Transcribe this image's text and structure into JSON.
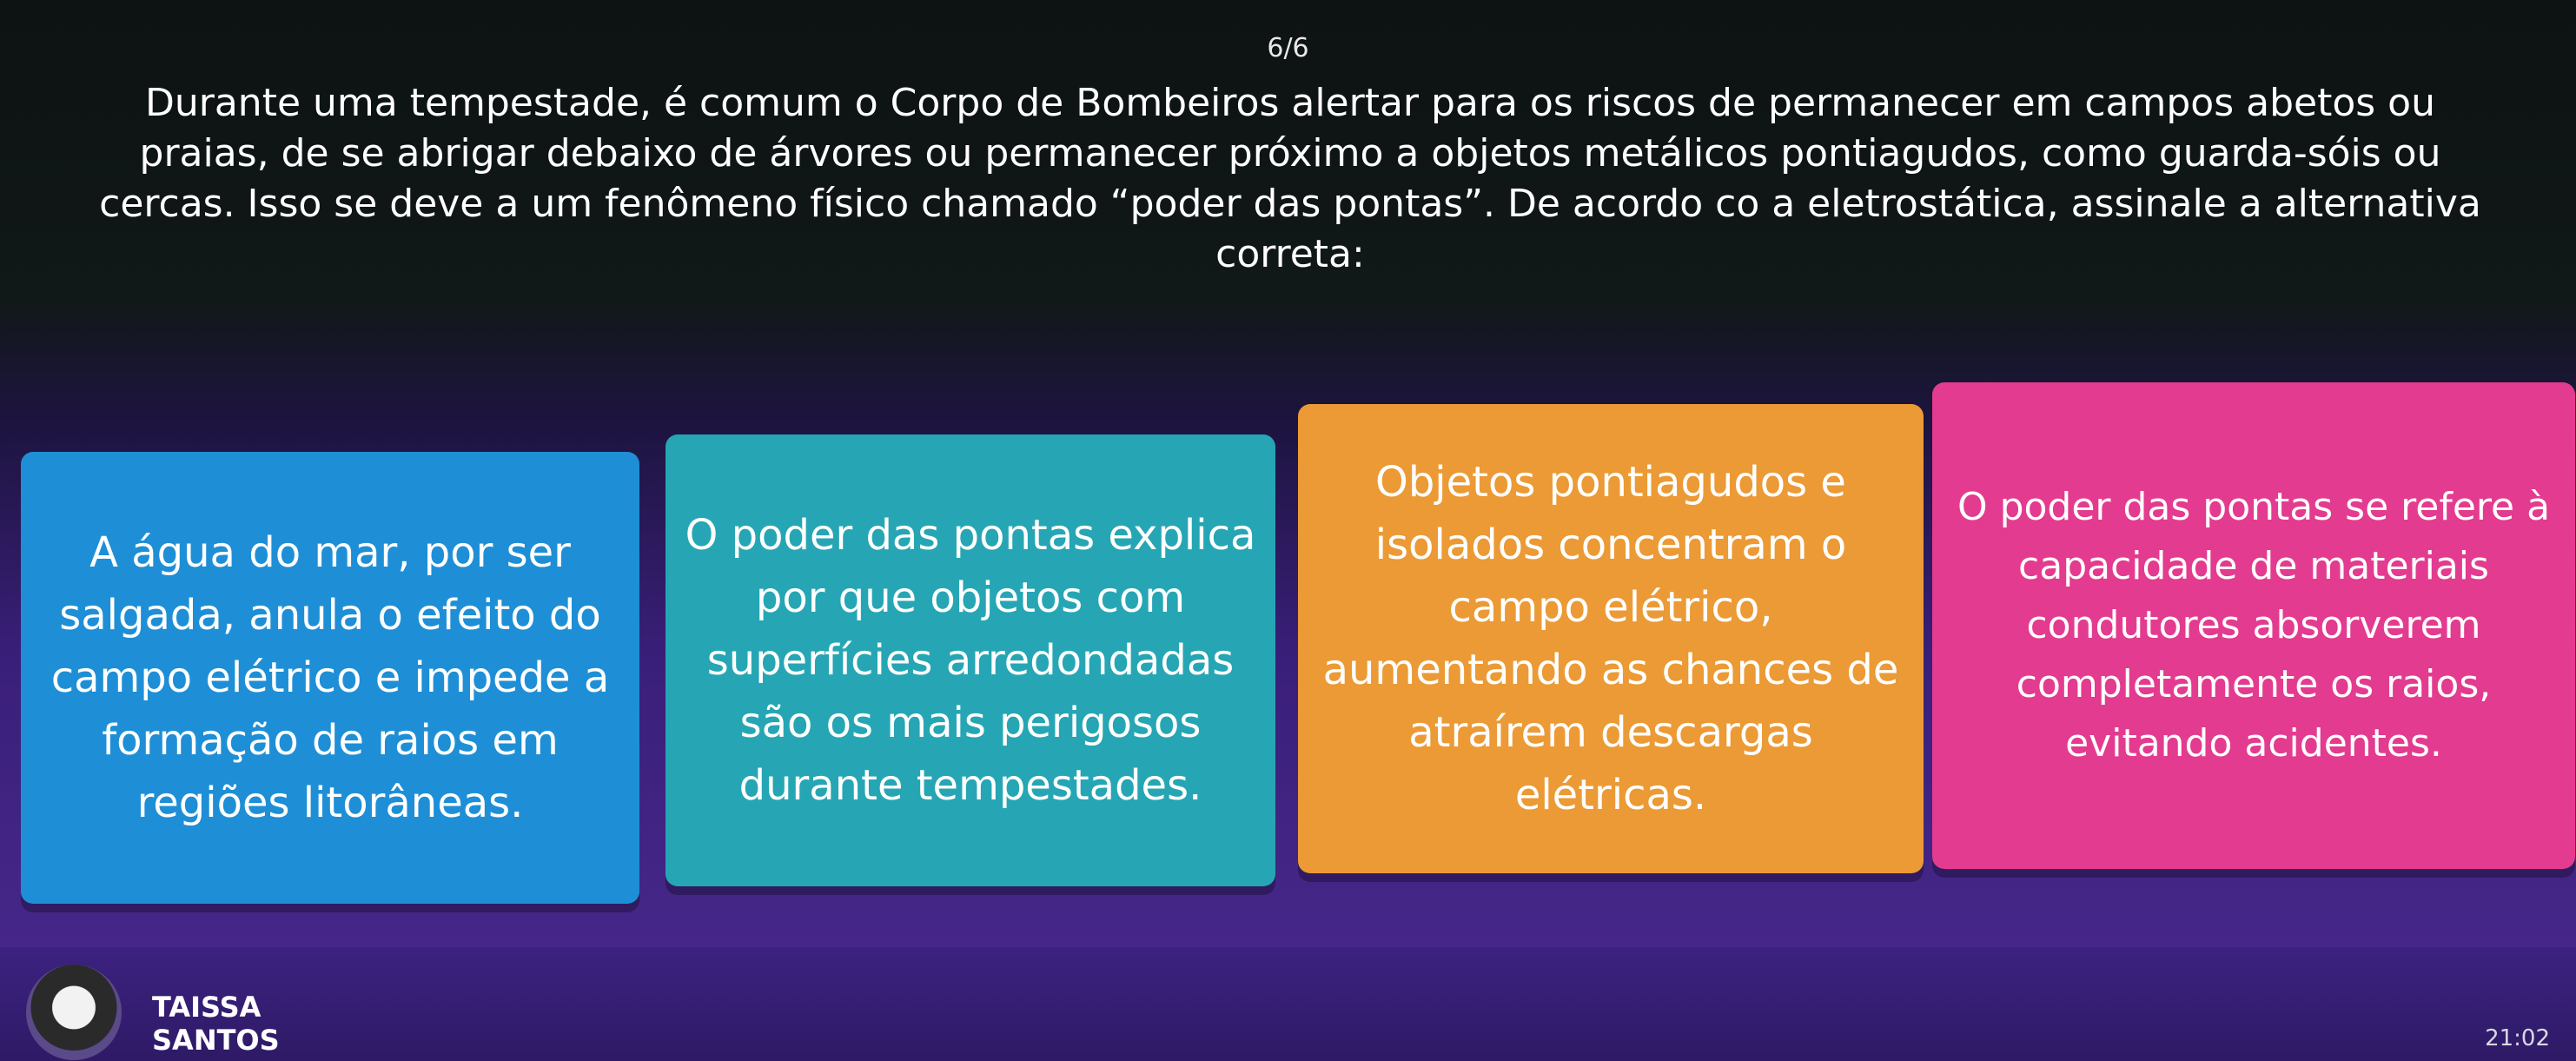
{
  "quiz": {
    "counter": "6/6",
    "question": "Durante uma tempestade, é comum o Corpo de Bombeiros alertar para os riscos de permanecer em campos abetos ou praias, de se abrigar debaixo de árvores ou permanecer próximo a objetos metálicos pontiagudos, como guarda-sóis ou cercas. Isso se deve a um fenômeno físico chamado “poder das pontas”. De acordo co a eletrostática, assinale a alternativa correta:",
    "answers": [
      {
        "text": "A água do mar, por ser salgada, anula o efeito do campo elétrico e impede a formação de raios em regiões litorâneas.",
        "color": "#1e8fd6"
      },
      {
        "text": "O poder das pontas explica por que objetos com superfícies arredondadas são os mais perigosos durante tempestades.",
        "color": "#26a6b4"
      },
      {
        "text": "Objetos pontiagudos e isolados concentram o campo elétrico, aumentando as chances de atraírem descargas elétricas.",
        "color": "#eb9a35"
      },
      {
        "text": "O poder das pontas se refere à capacidade de materiais condutores absorverem completamente os raios, evitando acidentes.",
        "color": "#e33b8f"
      }
    ]
  },
  "player": {
    "name": "TAISSA SANTOS"
  },
  "system": {
    "clock": "21:02"
  }
}
